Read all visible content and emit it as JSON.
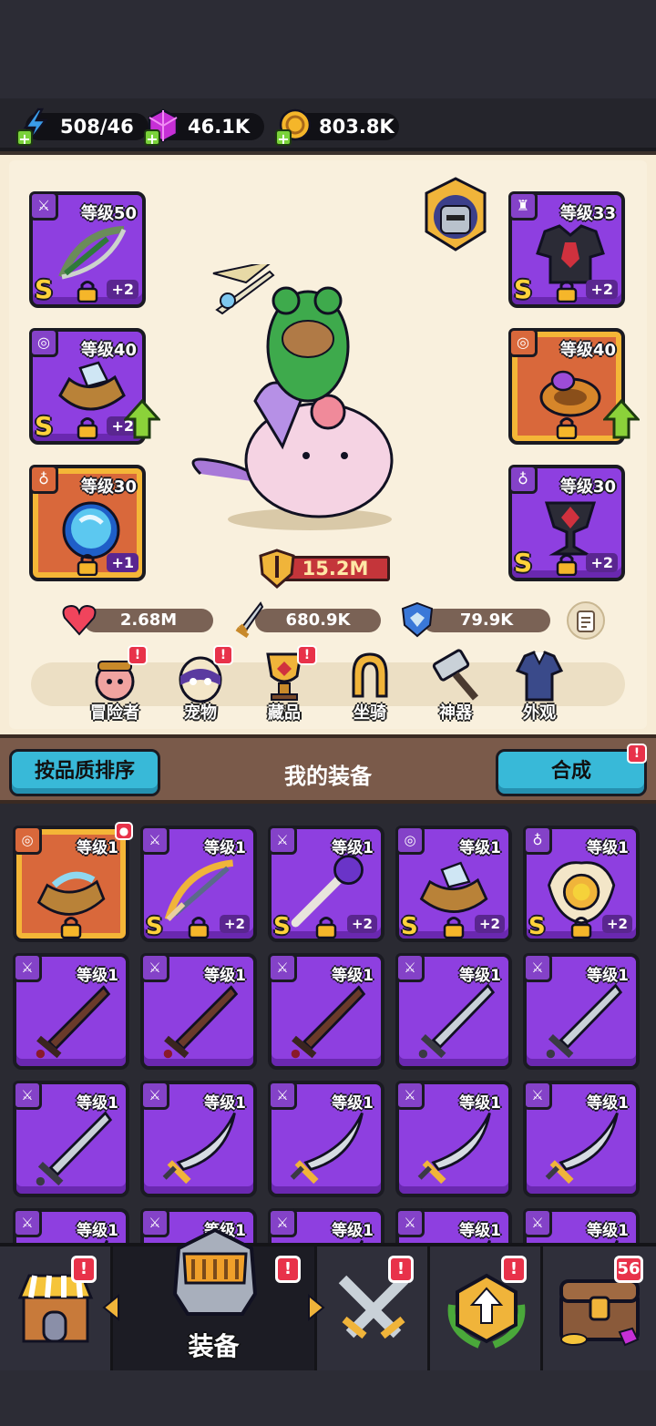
{
  "resources": {
    "energy": "508/46",
    "gems": "46.1K",
    "coins": "803.8K"
  },
  "hero": {
    "equip_left": [
      {
        "level": "等级50",
        "grade": "S",
        "plus": "+2",
        "rarity": "purple",
        "slot": "weapon"
      },
      {
        "level": "等级40",
        "grade": "S",
        "plus": "+2",
        "rarity": "purple",
        "slot": "ring"
      },
      {
        "level": "等级30",
        "grade": "",
        "plus": "+1",
        "rarity": "orange",
        "slot": "necklace"
      }
    ],
    "equip_right": [
      {
        "level": "等级33",
        "grade": "S",
        "plus": "+2",
        "rarity": "purple",
        "slot": "armor"
      },
      {
        "level": "等级40",
        "grade": "",
        "plus": "",
        "rarity": "orange",
        "slot": "ring"
      },
      {
        "level": "等级30",
        "grade": "S",
        "plus": "+2",
        "rarity": "purple",
        "slot": "necklace"
      }
    ],
    "power": "15.2M",
    "stats": {
      "hp": "2.68M",
      "attack": "680.9K",
      "defense": "79.9K"
    }
  },
  "menu": {
    "items": [
      {
        "label": "冒险者",
        "badge": "!"
      },
      {
        "label": "宠物",
        "badge": "!"
      },
      {
        "label": "藏品",
        "badge": "!"
      },
      {
        "label": "坐骑",
        "badge": ""
      },
      {
        "label": "神器",
        "badge": ""
      },
      {
        "label": "外观",
        "badge": ""
      }
    ]
  },
  "bag": {
    "sort_label": "按品质排序",
    "title": "我的装备",
    "merge_label": "合成",
    "merge_badge": "!",
    "items": [
      {
        "level": "等级1",
        "grade": "",
        "plus": "",
        "rarity": "orange",
        "slot": "ring",
        "art": "bracelet",
        "locked": true
      },
      {
        "level": "等级1",
        "grade": "S",
        "plus": "+2",
        "rarity": "purple",
        "slot": "weapon",
        "art": "crossbow",
        "locked": true
      },
      {
        "level": "等级1",
        "grade": "S",
        "plus": "+2",
        "rarity": "purple",
        "slot": "weapon",
        "art": "staff",
        "locked": true
      },
      {
        "level": "等级1",
        "grade": "S",
        "plus": "+2",
        "rarity": "purple",
        "slot": "ring",
        "art": "bracer",
        "locked": true
      },
      {
        "level": "等级1",
        "grade": "S",
        "plus": "+2",
        "rarity": "purple",
        "slot": "necklace",
        "art": "medal",
        "locked": true
      },
      {
        "level": "等级1",
        "grade": "",
        "plus": "",
        "rarity": "purple",
        "slot": "weapon",
        "art": "wood-sword",
        "locked": false
      },
      {
        "level": "等级1",
        "grade": "",
        "plus": "",
        "rarity": "purple",
        "slot": "weapon",
        "art": "wood-sword",
        "locked": false
      },
      {
        "level": "等级1",
        "grade": "",
        "plus": "",
        "rarity": "purple",
        "slot": "weapon",
        "art": "wood-sword",
        "locked": false
      },
      {
        "level": "等级1",
        "grade": "",
        "plus": "",
        "rarity": "purple",
        "slot": "weapon",
        "art": "steel-sword",
        "locked": false
      },
      {
        "level": "等级1",
        "grade": "",
        "plus": "",
        "rarity": "purple",
        "slot": "weapon",
        "art": "steel-sword",
        "locked": false
      },
      {
        "level": "等级1",
        "grade": "",
        "plus": "",
        "rarity": "purple",
        "slot": "weapon",
        "art": "steel-sword",
        "locked": false
      },
      {
        "level": "等级1",
        "grade": "",
        "plus": "",
        "rarity": "purple",
        "slot": "weapon",
        "art": "scimitar",
        "locked": false
      },
      {
        "level": "等级1",
        "grade": "",
        "plus": "",
        "rarity": "purple",
        "slot": "weapon",
        "art": "scimitar",
        "locked": false
      },
      {
        "level": "等级1",
        "grade": "",
        "plus": "",
        "rarity": "purple",
        "slot": "weapon",
        "art": "scimitar",
        "locked": false
      },
      {
        "level": "等级1",
        "grade": "",
        "plus": "",
        "rarity": "purple",
        "slot": "weapon",
        "art": "scimitar",
        "locked": false
      },
      {
        "level": "等级1",
        "grade": "",
        "plus": "",
        "rarity": "purple",
        "slot": "weapon",
        "art": "scimitar",
        "locked": false
      },
      {
        "level": "等级1",
        "grade": "",
        "plus": "",
        "rarity": "purple",
        "slot": "weapon",
        "art": "scimitar",
        "locked": false
      },
      {
        "level": "等级1",
        "grade": "",
        "plus": "",
        "rarity": "purple",
        "slot": "weapon",
        "art": "scimitar",
        "locked": false
      },
      {
        "level": "等级1",
        "grade": "",
        "plus": "",
        "rarity": "purple",
        "slot": "weapon",
        "art": "scimitar",
        "locked": false
      },
      {
        "level": "等级1",
        "grade": "",
        "plus": "",
        "rarity": "purple",
        "slot": "weapon",
        "art": "scimitar",
        "locked": false
      }
    ]
  },
  "nav": {
    "tabs": [
      {
        "icon": "shop-icon",
        "label": "",
        "badge": "!"
      },
      {
        "icon": "helmet-icon",
        "label": "装备",
        "badge": "!"
      },
      {
        "icon": "crossed-swords-icon",
        "label": "",
        "badge": "!"
      },
      {
        "icon": "upgrade-icon",
        "label": "",
        "badge": "!"
      },
      {
        "icon": "treasure-chest-icon",
        "label": "",
        "badge": "56"
      }
    ]
  },
  "colors": {
    "purple_card": "#8e3fe0",
    "orange_card": "#d9683b",
    "gold_border": "#f4b637",
    "cyan_button": "#38b9d8",
    "badge_red": "#e8324a"
  }
}
